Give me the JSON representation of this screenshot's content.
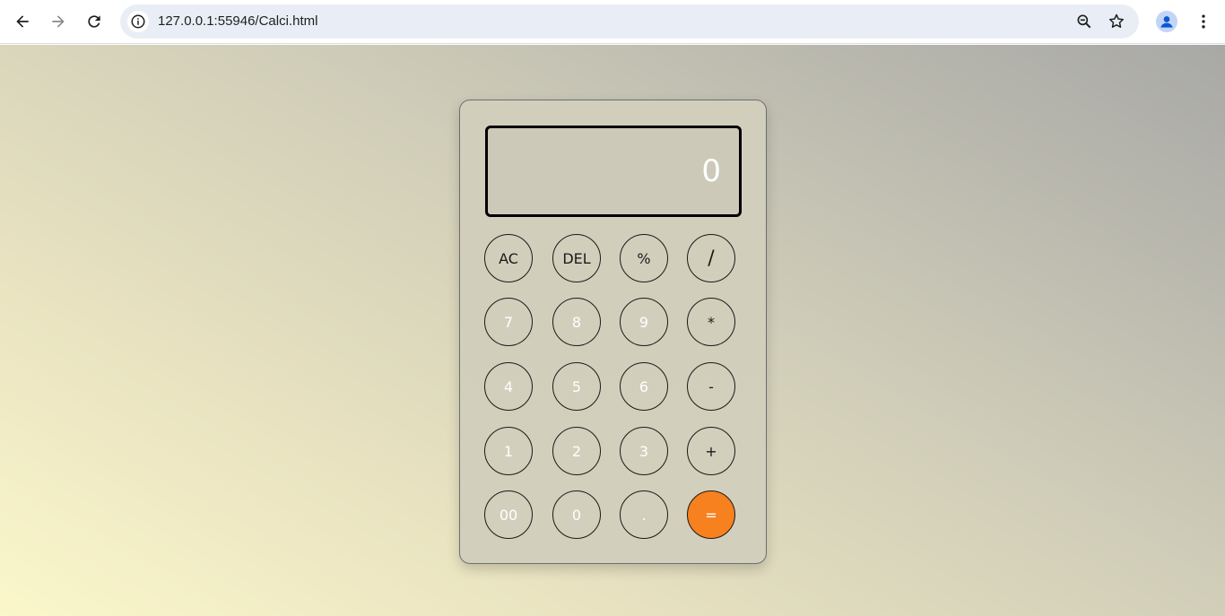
{
  "browser": {
    "url": "127.0.0.1:55946/Calci.html",
    "back_icon": "arrow-left-icon",
    "forward_icon": "arrow-right-icon",
    "reload_icon": "reload-icon",
    "info_icon": "info-icon",
    "zoom_icon": "zoom-out-icon",
    "bookmark_icon": "star-icon",
    "profile_icon": "profile-icon",
    "menu_icon": "more-vert-icon"
  },
  "calculator": {
    "display": "0",
    "keys": {
      "ac": "AC",
      "del": "DEL",
      "percent": "%",
      "divide": "/",
      "seven": "7",
      "eight": "8",
      "nine": "9",
      "multiply": "*",
      "four": "4",
      "five": "5",
      "six": "6",
      "minus": "-",
      "one": "1",
      "two": "2",
      "three": "3",
      "plus": "+",
      "double_zero": "00",
      "zero": "0",
      "dot": ".",
      "equals": "="
    }
  },
  "colors": {
    "equals_key": "#f7801f",
    "number_text": "#ffffff",
    "operator_text": "#1a1a1a"
  }
}
